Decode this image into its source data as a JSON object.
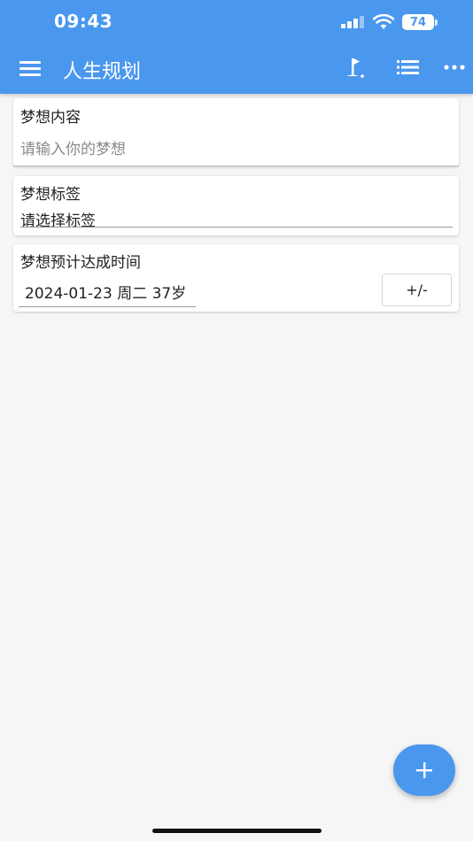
{
  "status_bar": {
    "time": "09:43",
    "battery": "74",
    "icons": [
      "cellular-signal-icon",
      "wifi-icon",
      "battery-icon"
    ]
  },
  "app_bar": {
    "title": "人生规划",
    "icons": {
      "menu": "menu-icon",
      "goal": "golf-flag-icon",
      "list": "list-icon",
      "more": "more-horizontal-icon"
    },
    "color": "#4a97ee"
  },
  "form": {
    "dream_content": {
      "label": "梦想内容",
      "placeholder": "请输入你的梦想"
    },
    "dream_tag": {
      "label": "梦想标签",
      "value": "请选择标签"
    },
    "dream_date": {
      "label": "梦想预计达成时间",
      "value": "2024-01-23 周二 37岁",
      "stepper_label": "+/-"
    }
  },
  "fab": {
    "icon": "plus-icon",
    "symbol": "+"
  }
}
